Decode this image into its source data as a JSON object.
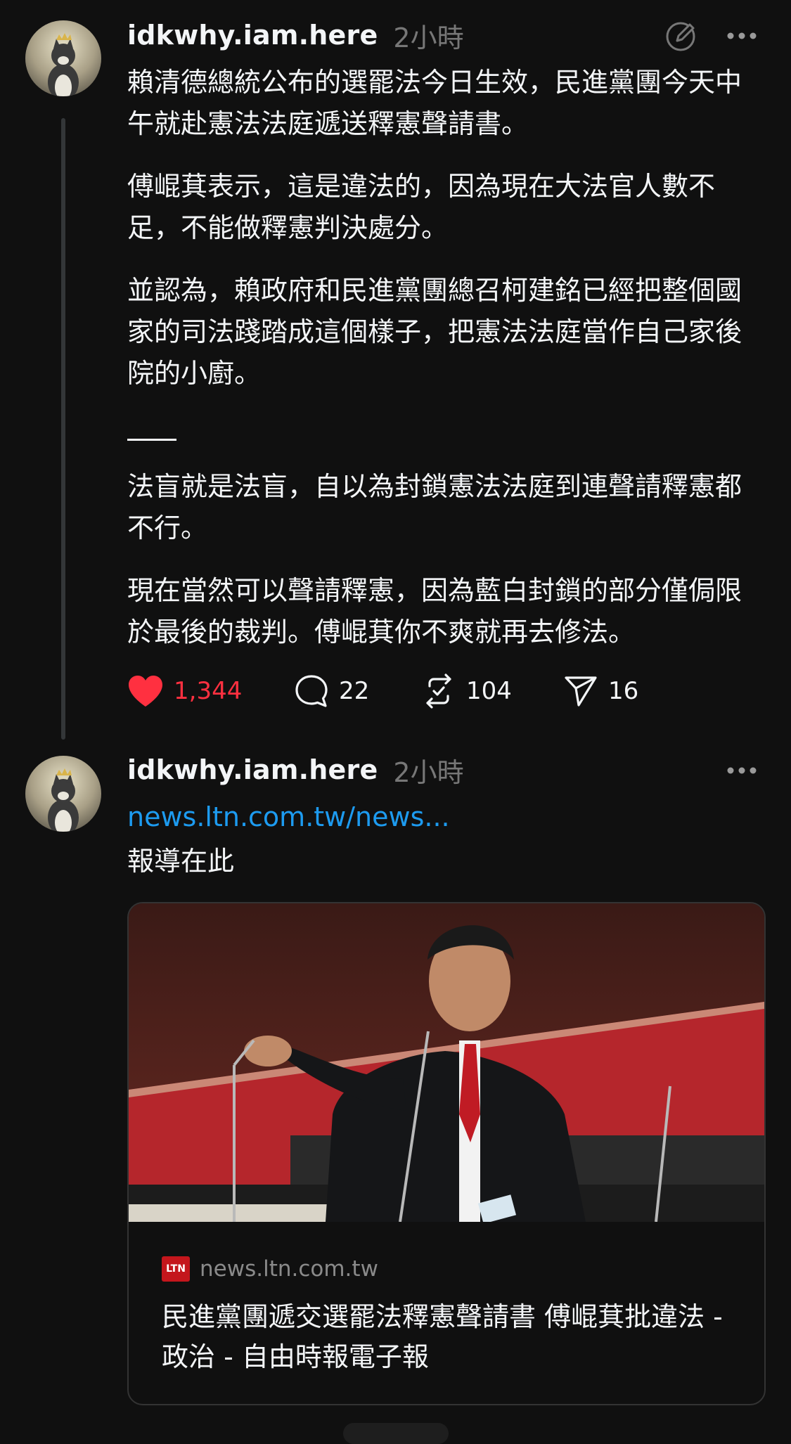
{
  "post1": {
    "username": "idkwhy.iam.here",
    "time": "2小時",
    "paragraphs": [
      "賴清德總統公布的選罷法今日生效，民進黨團今天中午就赴憲法法庭遞送釋憲聲請書。",
      "傅崐萁表示，這是違法的，因為現在大法官人數不足，不能做釋憲判決處分。",
      "並認為，賴政府和民進黨團總召柯建銘已經把整個國家的司法踐踏成這個樣子，把憲法法庭當作自己家後院的小廚。",
      "法盲就是法盲，自以為封鎖憲法法庭到連聲請釋憲都不行。",
      "現在當然可以聲請釋憲，因為藍白封鎖的部分僅侷限於最後的裁判。傅崐萁你不爽就再去修法。"
    ],
    "actions": {
      "likes": "1,344",
      "replies": "22",
      "reposts": "104",
      "shares": "16"
    },
    "like_color": "#ff3040"
  },
  "post2": {
    "username": "idkwhy.iam.here",
    "time": "2小時",
    "link": "news.ltn.com.tw/news...",
    "text": "報導在此",
    "card": {
      "badge": "LTN",
      "domain": "news.ltn.com.tw",
      "title": "民進黨團遞交選罷法釋憲聲請書 傅崐萁批違法 - 政治 - 自由時報電子報"
    }
  },
  "icons": {
    "edit": "edit-icon",
    "more": "more-icon",
    "heart": "heart-icon",
    "reply": "comment-icon",
    "repost": "repost-icon",
    "share": "send-icon"
  },
  "colors": {
    "background": "#101010",
    "link": "#1d9bf0",
    "secondary": "#777777"
  }
}
